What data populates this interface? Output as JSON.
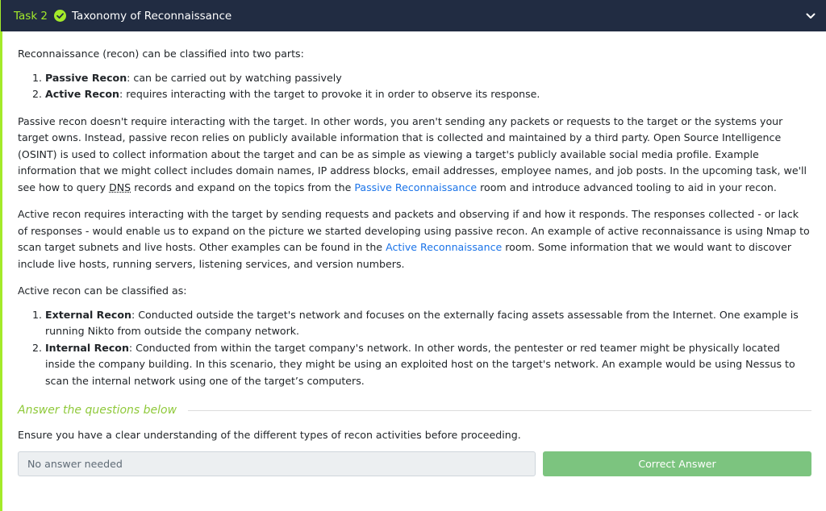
{
  "header": {
    "task_label": "Task 2",
    "title": "Taxonomy of Reconnaissance"
  },
  "content": {
    "intro": "Reconnaissance (recon) can be classified into two parts:",
    "list1": [
      {
        "term": "Passive Recon",
        "text": ": can be carried out by watching passively"
      },
      {
        "term": "Active Recon",
        "text": ": requires interacting with the target to provoke it in order to observe its response."
      }
    ],
    "passive_para": {
      "part1": "Passive recon doesn't require interacting with the target. In other words, you aren't sending any packets or requests to the target or the systems your target owns. Instead, passive recon relies on publicly available information that is collected and maintained by a third party. Open Source Intelligence (OSINT) is used to collect information about the target and can be as simple as viewing a target's publicly available social media profile. Example information that we might collect includes domain names, IP address blocks, email addresses, employee names, and job posts. In the upcoming task, we'll see how to query ",
      "dns": "DNS",
      "part2": " records and expand on the topics from the ",
      "link": "Passive Reconnaissance",
      "part3": " room and introduce advanced tooling to aid in your recon."
    },
    "active_para": {
      "part1": "Active recon requires interacting with the target by sending requests and packets and observing if and how it responds. The responses collected - or lack of responses - would enable us to expand on the picture we started developing using passive recon. An example of active reconnaissance is using Nmap to scan target subnets and live hosts. Other examples can be found in the ",
      "link": "Active Reconnaissance",
      "part2": " room. Some information that we would want to discover include live hosts, running servers, listening services, and version numbers."
    },
    "classified": "Active recon can be classified as:",
    "list2": [
      {
        "term": "External Recon",
        "text": ": Conducted outside the target's network and focuses on the externally facing assets assessable from the Internet. One example is running Nikto from outside the company network."
      },
      {
        "term": "Internal Recon",
        "text": ": Conducted from within the target company's network. In other words, the pentester or red teamer might be physically located inside the company building. In this scenario, they might be using an exploited host on the target's network. An example would be using Nessus to scan the internal network using one of the target’s computers."
      }
    ]
  },
  "answers": {
    "heading": "Answer the questions below",
    "question": "Ensure you have a clear understanding of the different types of recon activities before proceeding.",
    "input_value": "No answer needed",
    "button_label": "Correct Answer"
  },
  "colors": {
    "header_bg": "#212c42",
    "accent_green": "#a3ea2a",
    "button_green": "#7cc47f",
    "link_blue": "#1a73e8"
  },
  "icons": {
    "status": "check-circle-icon",
    "toggle": "chevron-down-icon"
  }
}
